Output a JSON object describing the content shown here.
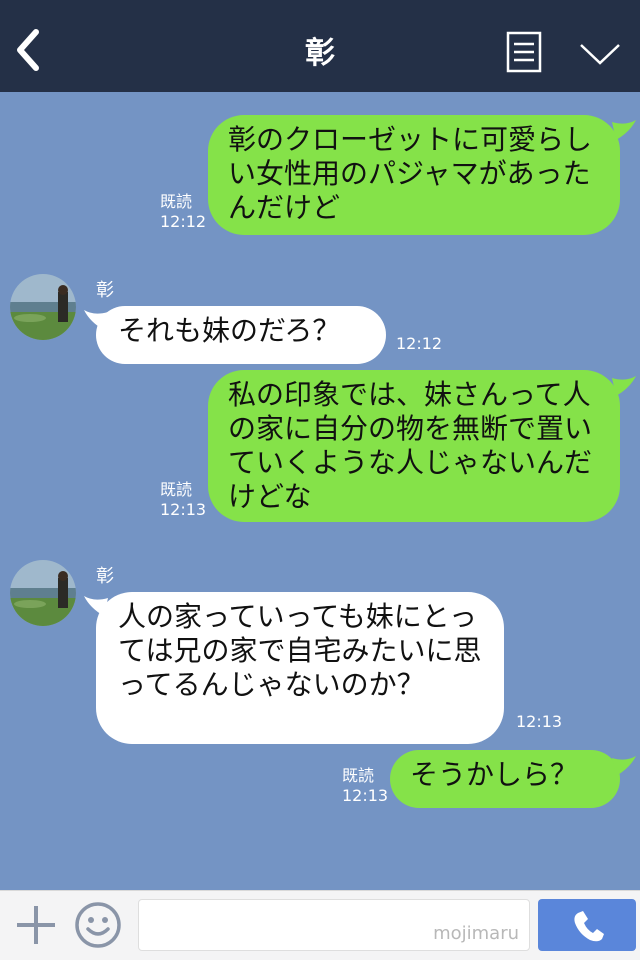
{
  "header": {
    "title": "彰"
  },
  "messages": [
    {
      "dir": "out",
      "text": "彰のクローゼットに可愛らしい女性用のパジャマがあったんだけど",
      "read": "既読",
      "time": "12:12"
    },
    {
      "dir": "in",
      "sender": "彰",
      "text": "それも妹のだろ？",
      "time": "12:12"
    },
    {
      "dir": "out",
      "text": "私の印象では、妹さんって人の家に自分の物を無断で置いていくような人じゃないんだけどな",
      "read": "既読",
      "time": "12:13"
    },
    {
      "dir": "in",
      "sender": "彰",
      "text": "人の家っていっても妹にとっては兄の家で自宅みたいに思ってるんじゃないのか？",
      "time": "12:13"
    },
    {
      "dir": "out",
      "text": "そうかしら？",
      "read": "既読",
      "time": "12:13"
    }
  ],
  "footer": {
    "watermark": "mojimaru"
  },
  "colors": {
    "header": "#243047",
    "background": "#7494c4",
    "outgoing": "#85e249",
    "incoming": "#ffffff",
    "call": "#5a86da"
  }
}
